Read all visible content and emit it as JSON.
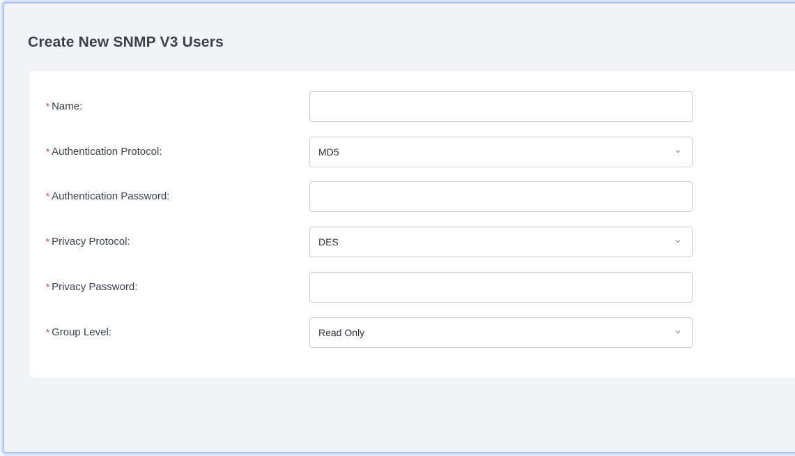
{
  "page": {
    "title": "Create New SNMP V3 Users"
  },
  "form": {
    "required_marker": "*",
    "fields": [
      {
        "label": "Name:",
        "type": "text",
        "value": ""
      },
      {
        "label": "Authentication Protocol:",
        "type": "select",
        "value": "MD5"
      },
      {
        "label": "Authentication Password:",
        "type": "text",
        "value": ""
      },
      {
        "label": "Privacy Protocol:",
        "type": "select",
        "value": "DES"
      },
      {
        "label": "Privacy Password:",
        "type": "text",
        "value": ""
      },
      {
        "label": "Group Level:",
        "type": "select",
        "value": "Read Only"
      }
    ]
  },
  "icons": {
    "select_arrow": "chevron-down-icon"
  },
  "colors": {
    "required": "#e0312f",
    "frame_border": "#a9c4f0",
    "background": "#f3f4f8"
  }
}
